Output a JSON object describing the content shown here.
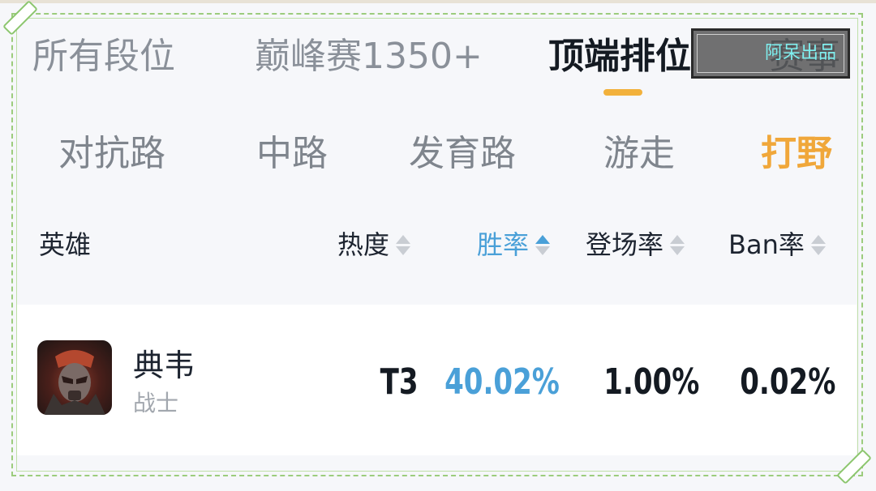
{
  "rank_tabs": [
    {
      "label": "所有段位",
      "active": false
    },
    {
      "label": "巅峰赛1350+",
      "active": false
    },
    {
      "label": "顶端排位",
      "active": true
    },
    {
      "label": "赛事",
      "active": false
    }
  ],
  "watermark": "阿呆出品",
  "lane_tabs": [
    {
      "label": "对抗路",
      "active": false
    },
    {
      "label": "中路",
      "active": false
    },
    {
      "label": "发育路",
      "active": false
    },
    {
      "label": "游走",
      "active": false
    },
    {
      "label": "打野",
      "active": true
    }
  ],
  "table": {
    "columns": [
      {
        "label": "英雄",
        "sortable": false
      },
      {
        "label": "热度",
        "sortable": true,
        "sorted": false
      },
      {
        "label": "胜率",
        "sortable": true,
        "sorted": true
      },
      {
        "label": "登场率",
        "sortable": true,
        "sorted": false
      },
      {
        "label": "Ban率",
        "sortable": true,
        "sorted": false
      }
    ],
    "rows": [
      {
        "name": "典韦",
        "role": "战士",
        "tier": "T3",
        "win_rate": "40.02%",
        "pick_rate": "1.00%",
        "ban_rate": "0.02%"
      }
    ]
  },
  "colors": {
    "accent_orange": "#f0a73a",
    "accent_blue": "#4aa0d8",
    "frame_green": "#9ccc7d"
  }
}
